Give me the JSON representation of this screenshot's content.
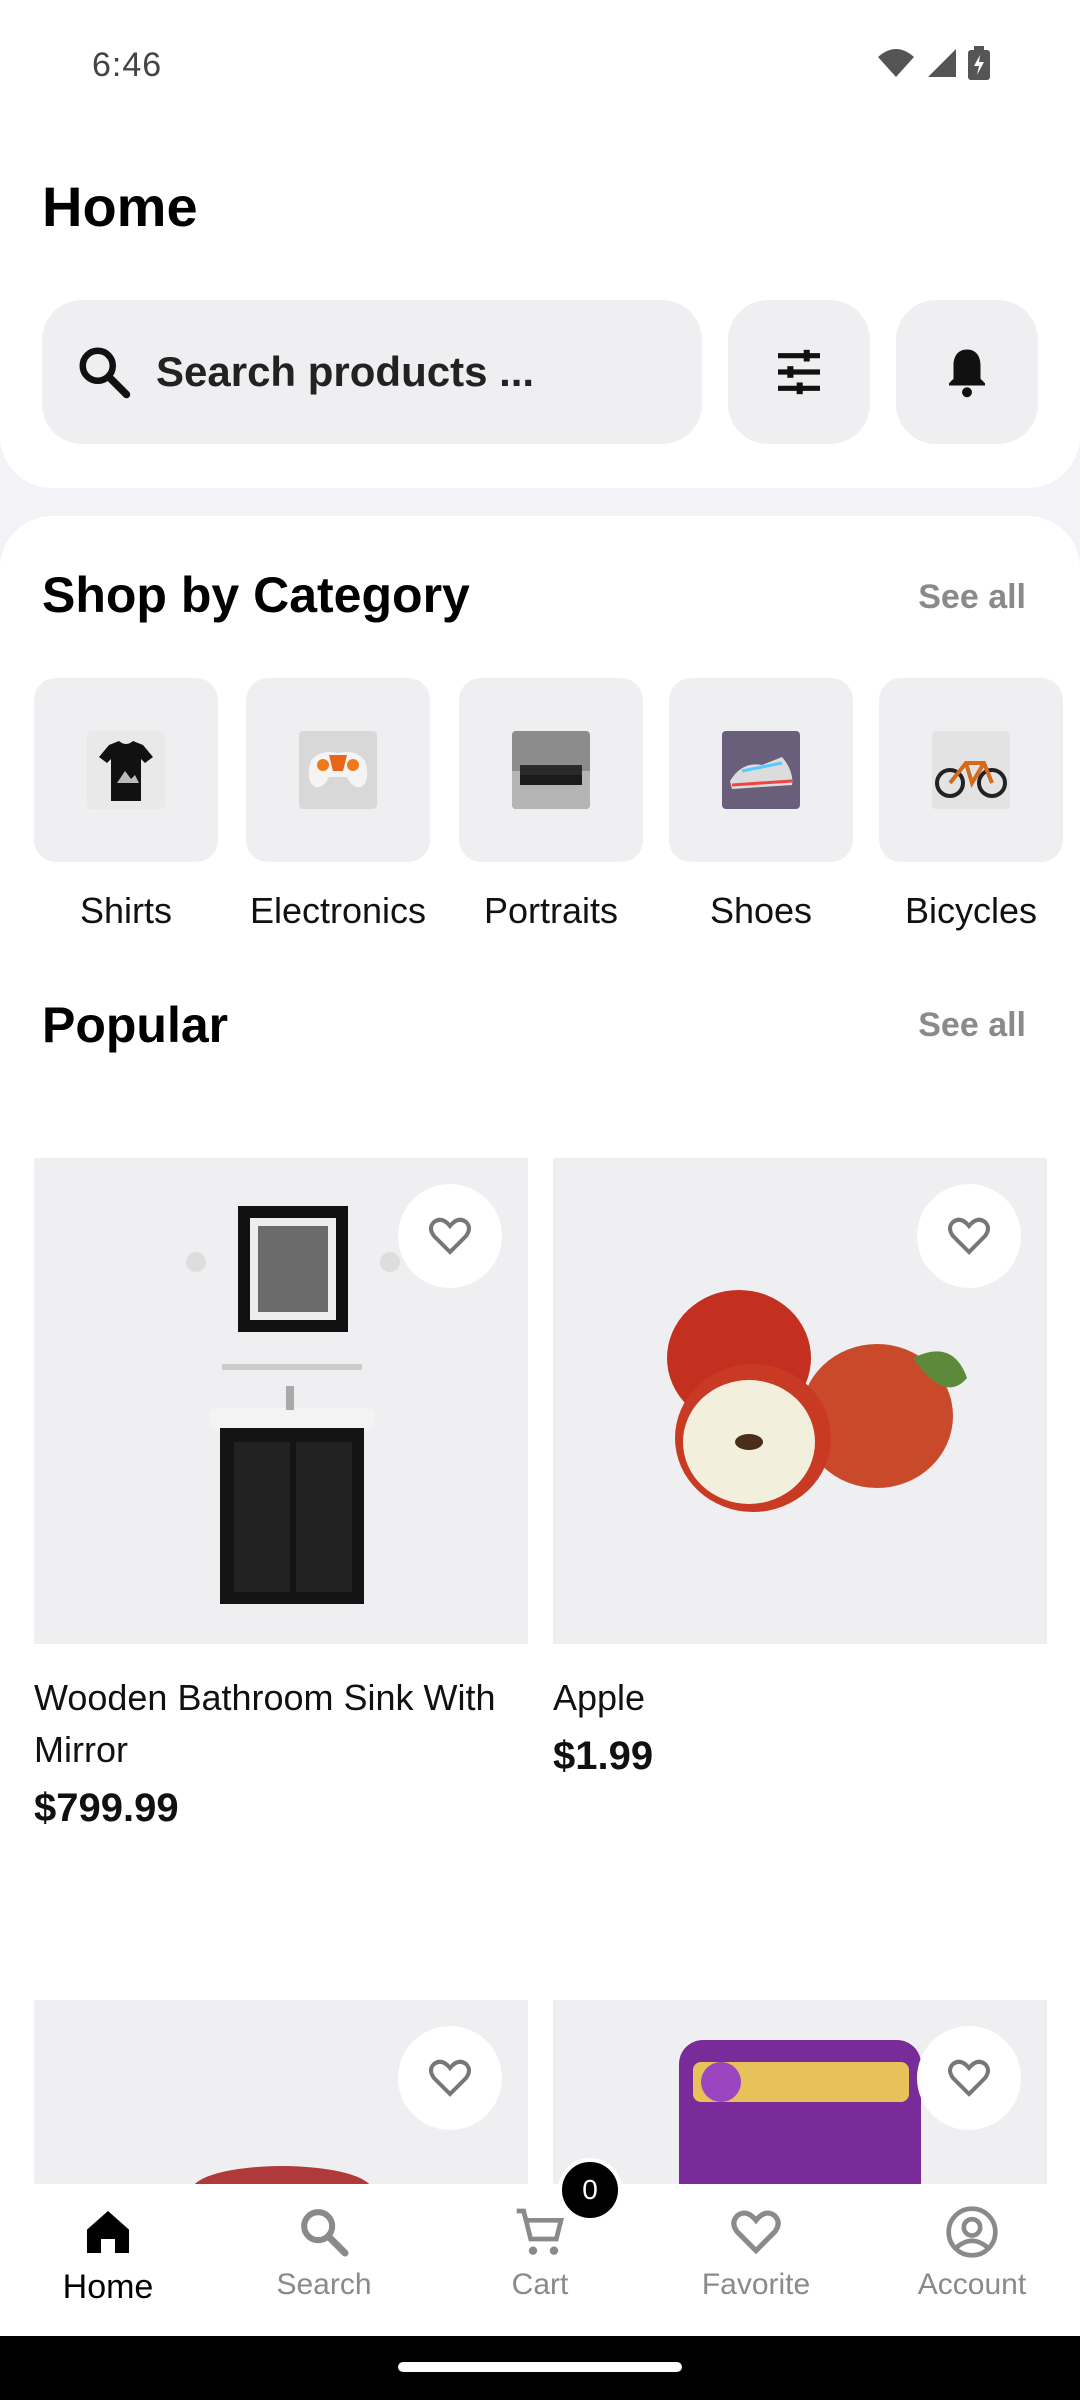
{
  "status_bar": {
    "time": "6:46"
  },
  "header": {
    "title": "Home",
    "search_placeholder": "Search products ...",
    "filter_icon": "sliders-icon",
    "notification_icon": "bell-icon"
  },
  "categories_section": {
    "title": "Shop by Category",
    "see_all": "See all",
    "items": [
      {
        "label": "Shirts"
      },
      {
        "label": "Electronics"
      },
      {
        "label": "Portraits"
      },
      {
        "label": "Shoes"
      },
      {
        "label": "Bicycles"
      }
    ]
  },
  "popular_section": {
    "title": "Popular",
    "see_all": "See all",
    "products": [
      {
        "name": "Wooden Bathroom Sink With Mirror",
        "price": "$799.99"
      },
      {
        "name": "Apple",
        "price": "$1.99"
      }
    ]
  },
  "bottom_nav": {
    "items": [
      {
        "label": "Home",
        "icon": "home-icon"
      },
      {
        "label": "Search",
        "icon": "search-icon"
      },
      {
        "label": "Cart",
        "icon": "cart-icon"
      },
      {
        "label": "Favorite",
        "icon": "heart-icon"
      },
      {
        "label": "Account",
        "icon": "account-icon"
      }
    ],
    "cart_count": "0"
  },
  "colors": {
    "accent": "#000000",
    "surface": "#efeff1",
    "muted": "#8a8a8a"
  }
}
